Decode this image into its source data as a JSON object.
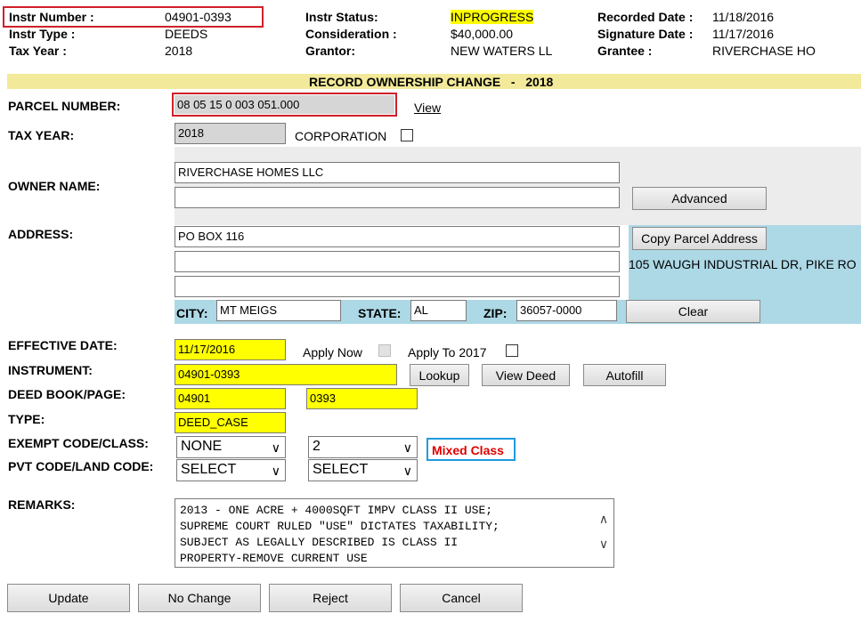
{
  "header": {
    "instr_number_label": "Instr Number :",
    "instr_number": "04901-0393",
    "instr_type_label": "Instr Type :",
    "instr_type": "DEEDS",
    "tax_year_label": "Tax Year :",
    "tax_year": "2018",
    "instr_status_label": "Instr Status:",
    "instr_status": "INPROGRESS",
    "consideration_label": "Consideration :",
    "consideration": "$40,000.00",
    "grantor_label": "Grantor:",
    "grantor": "NEW WATERS LL",
    "recorded_date_label": "Recorded Date :",
    "recorded_date": "11/18/2016",
    "signature_date_label": "Signature Date :",
    "signature_date": "11/17/2016",
    "grantee_label": "Grantee :",
    "grantee": "RIVERCHASE HO"
  },
  "section_title": "RECORD OWNERSHIP CHANGE   -   2018",
  "parcel": {
    "label": "PARCEL NUMBER:",
    "value": "08 05 15 0 003 051.000",
    "view_link": "View"
  },
  "tax_year_row": {
    "label": "TAX YEAR:",
    "value": "2018",
    "corporation_label": "CORPORATION"
  },
  "owner": {
    "label": "OWNER NAME:",
    "line1": "RIVERCHASE HOMES LLC",
    "line2": "",
    "advanced_button": "Advanced"
  },
  "address": {
    "label": "ADDRESS:",
    "line1": "PO BOX 116",
    "line2": "",
    "line3": "",
    "copy_button": "Copy Parcel Address",
    "parcel_address": "105 WAUGH INDUSTRIAL DR, PIKE RO",
    "city_label": "CITY:",
    "city": "MT MEIGS",
    "state_label": "STATE:",
    "state": "AL",
    "zip_label": "ZIP:",
    "zip": "36057-0000",
    "clear_button": "Clear"
  },
  "effective": {
    "label": "EFFECTIVE DATE:",
    "value": "11/17/2016",
    "apply_now_label": "Apply Now",
    "apply_to_label": "Apply To 2017"
  },
  "instrument": {
    "label": "INSTRUMENT:",
    "value": "04901-0393",
    "lookup_button": "Lookup",
    "view_deed_button": "View Deed",
    "autofill_button": "Autofill"
  },
  "deed": {
    "label": "DEED BOOK/PAGE:",
    "book": "04901",
    "page": "0393"
  },
  "type": {
    "label": "TYPE:",
    "value": "DEED_CASE"
  },
  "exempt": {
    "label": "EXEMPT CODE/CLASS:",
    "code": "NONE",
    "class": "2",
    "mixed_class": "Mixed Class"
  },
  "pvt": {
    "label": "PVT CODE/LAND CODE:",
    "pvt_code": "SELECT",
    "land_code": "SELECT"
  },
  "remarks": {
    "label": "REMARKS:",
    "text": "2013 - ONE ACRE + 4000SQFT IMPV CLASS II USE;\nSUPREME COURT RULED \"USE\" DICTATES TAXABILITY;\nSUBJECT AS LEGALLY DESCRIBED IS CLASS II\nPROPERTY-REMOVE CURRENT USE"
  },
  "actions": {
    "update": "Update",
    "no_change": "No Change",
    "reject": "Reject",
    "cancel": "Cancel"
  },
  "colors": {
    "section_bar": "#f2ea9a",
    "owner_panel": "#ececec",
    "address_panel": "#add8e6",
    "highlight": "#ffff00",
    "red_box": "#d0202a",
    "mixed_class_text": "#e00000",
    "mixed_class_border": "#1e9be0"
  }
}
